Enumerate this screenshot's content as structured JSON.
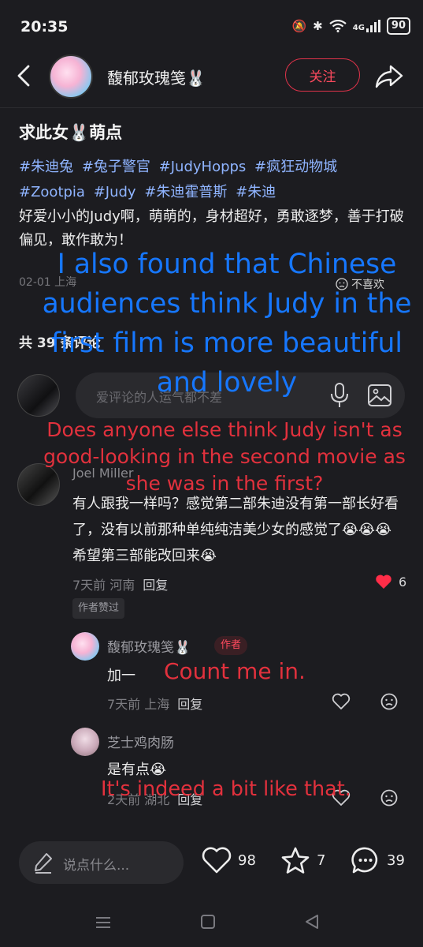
{
  "status_bar": {
    "time": "20:35",
    "signal": "4G",
    "battery": "90"
  },
  "header": {
    "author_name": "馥郁玫瑰笺🐰",
    "follow_label": "关注"
  },
  "post": {
    "title": "求此女🐰萌点",
    "tags": [
      "#朱迪兔",
      "#兔子警官",
      "#JudyHopps",
      "#疯狂动物城",
      "#Zootpia",
      "#Judy",
      "#朱迪霍普斯",
      "#朱迪"
    ],
    "body": "好爱小小的Judy啊，萌萌的，身材超好，勇敢逐梦，善于打破偏见，敢作敢为！",
    "date_location": "02-01 上海",
    "dislike_label": "不喜欢"
  },
  "comments_header": "共 39 条评论",
  "comment_input": {
    "placeholder": "爱评论的人运气都不差"
  },
  "comments": [
    {
      "name": "Joel Miller",
      "text": "有人跟我一样吗？感觉第二部朱迪没有第一部长好看了，没有以前那种单纯纯洁美少女的感觉了😭😭😭希望第三部能改回来😭",
      "time_location": "7天前 河南",
      "reply_label": "回复",
      "likes": "6",
      "badge": "作者赞过"
    }
  ],
  "replies": [
    {
      "name": "馥郁玫瑰笺🐰",
      "tag": "作者",
      "text": "加一",
      "time_location": "7天前 上海",
      "reply_label": "回复"
    },
    {
      "name": "芝士鸡肉肠",
      "text": "是有点😭",
      "time_location": "2天前 湖北",
      "reply_label": "回复"
    }
  ],
  "bottom_bar": {
    "say_placeholder": "说点什么...",
    "likes": "98",
    "favorites": "7",
    "comments": "39"
  },
  "overlays": {
    "blue_note": "I also found that Chinese audiences think Judy in the first film is more beautiful and lovely",
    "red_note_1": "Does anyone else think Judy isn't as good-looking in the second movie as she was in the first?",
    "red_note_2": "Count me in.",
    "red_note_3": "It's indeed a bit like that."
  },
  "colors": {
    "accent_red": "#e0334a",
    "tag_blue": "#8fb4ff",
    "overlay_blue": "#1677ff",
    "overlay_red": "#e2313d",
    "background": "#1c1c20"
  }
}
